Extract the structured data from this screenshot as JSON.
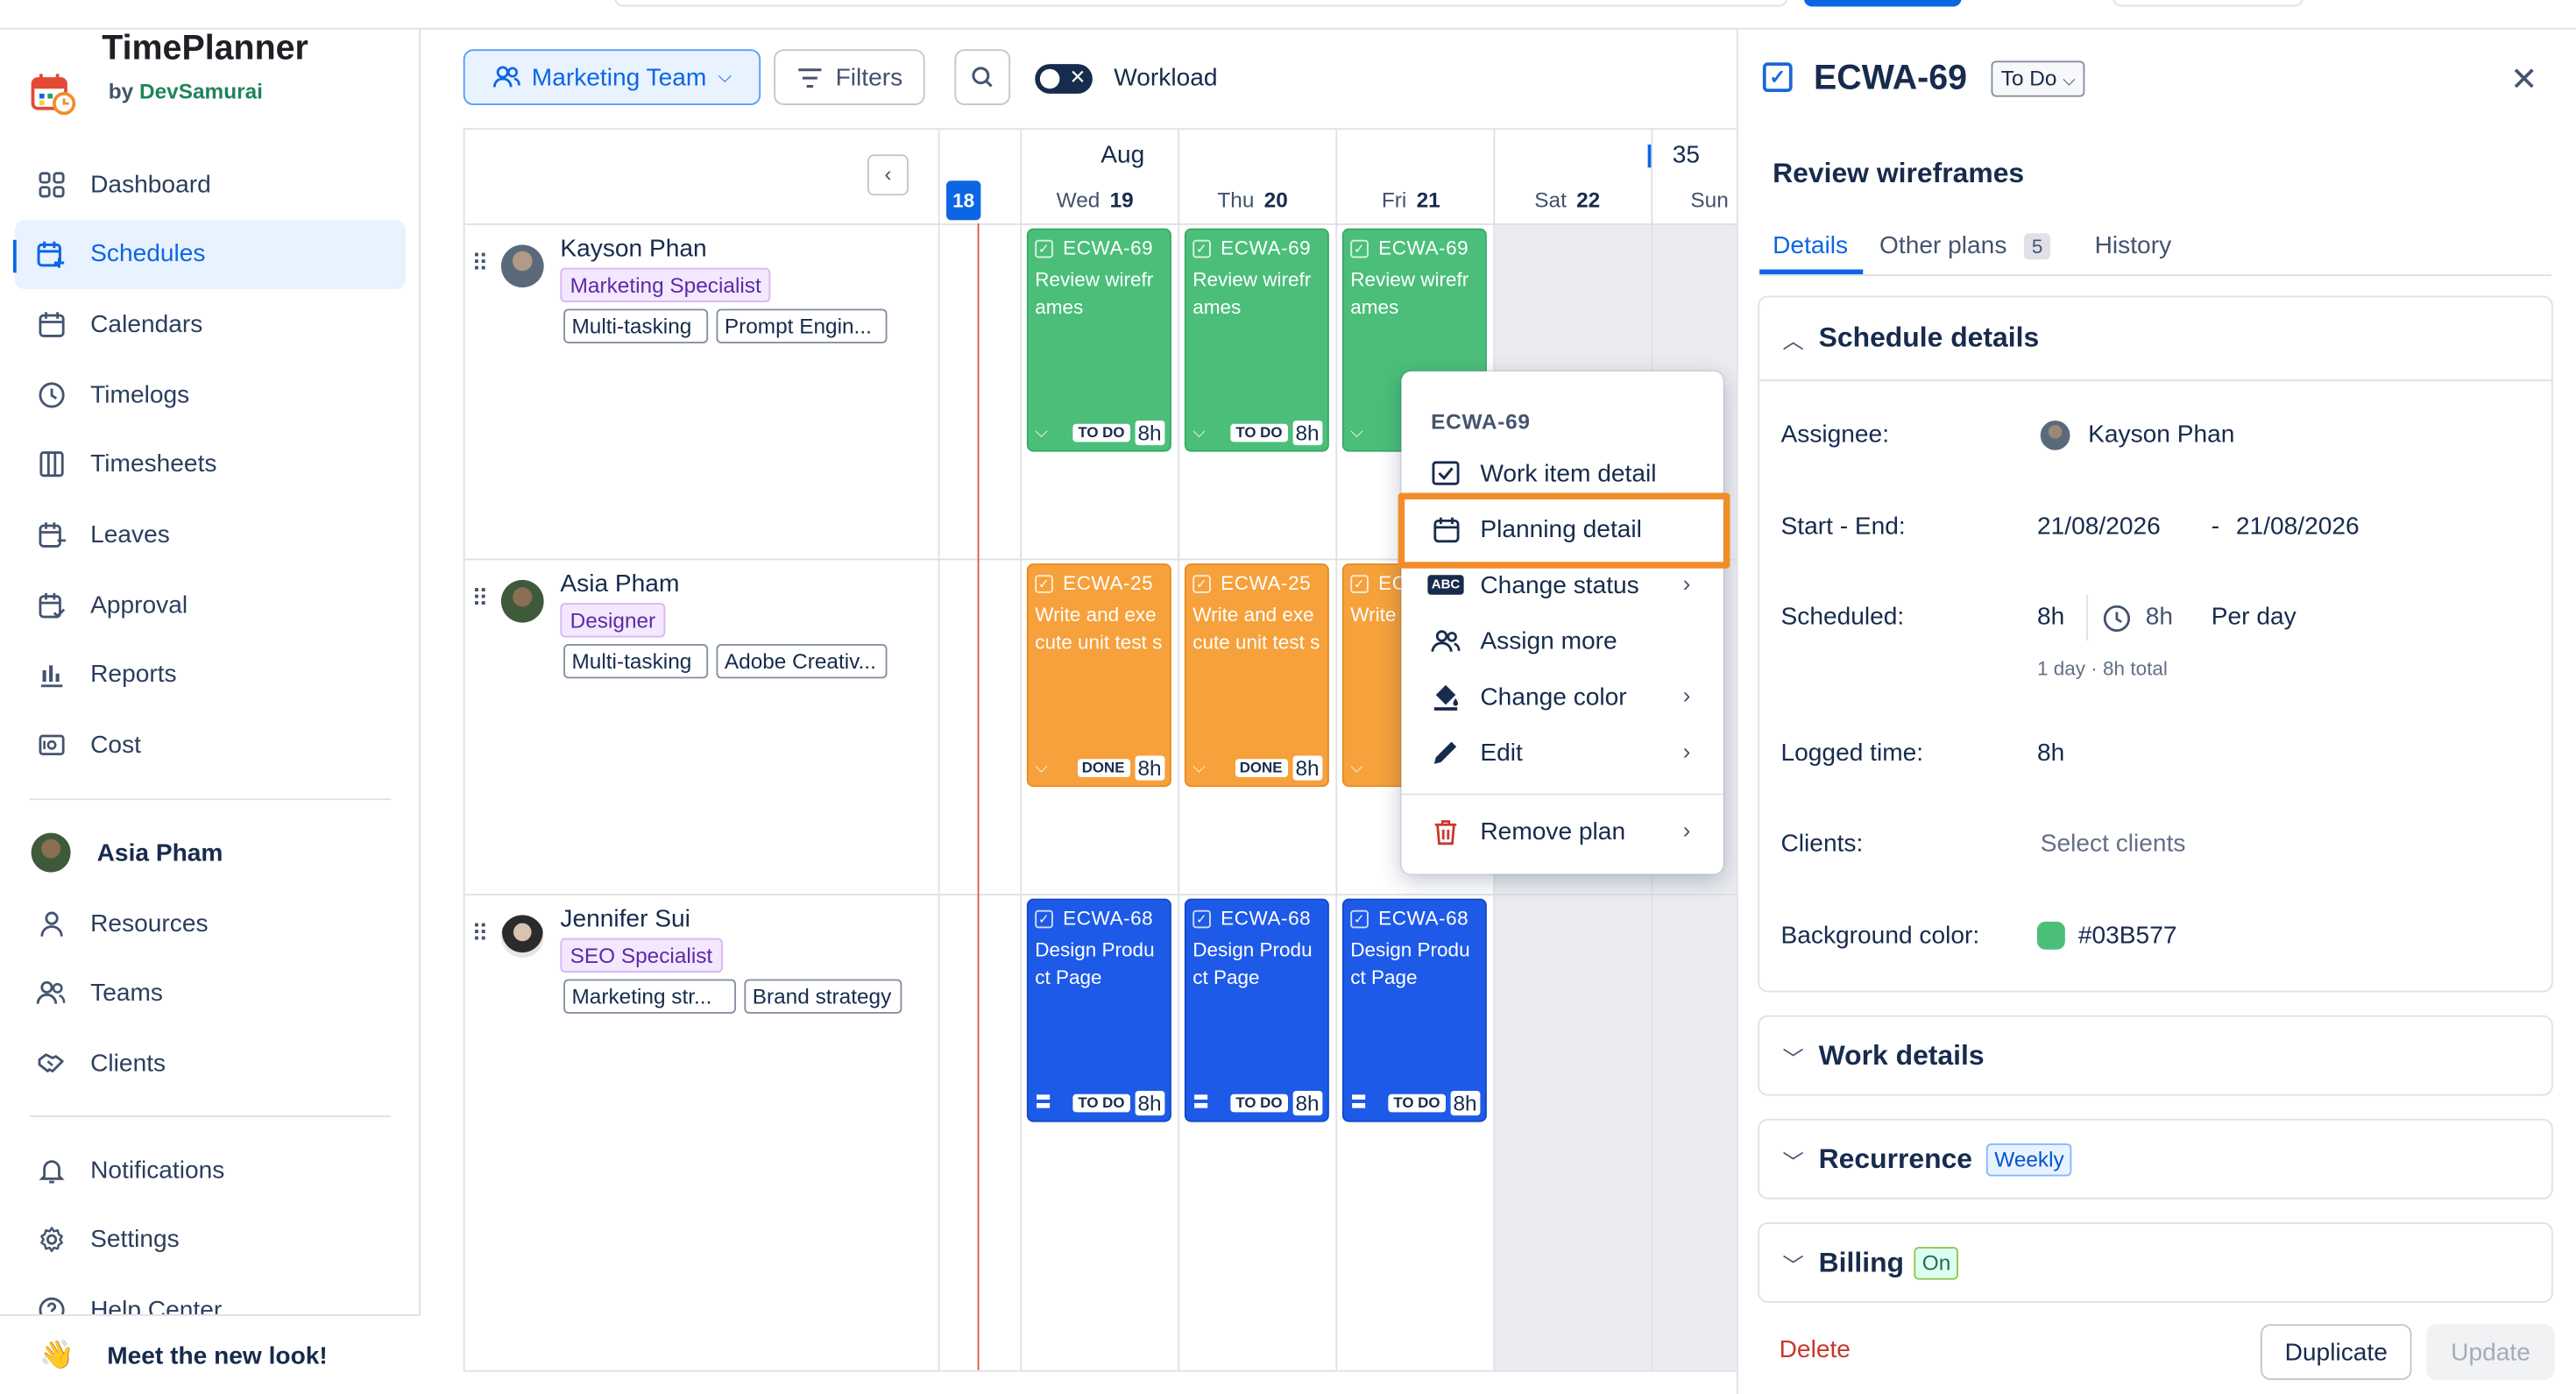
{
  "app": {
    "title": "TimePlanner",
    "by": "by",
    "vendor": "DevSamurai"
  },
  "sidebar": {
    "items": [
      {
        "label": "Dashboard",
        "icon": "dashboard-icon"
      },
      {
        "label": "Schedules",
        "icon": "schedules-icon"
      },
      {
        "label": "Calendars",
        "icon": "calendar-icon"
      },
      {
        "label": "Timelogs",
        "icon": "clock-icon"
      },
      {
        "label": "Timesheets",
        "icon": "timesheet-icon"
      },
      {
        "label": "Leaves",
        "icon": "leaves-icon"
      },
      {
        "label": "Approval",
        "icon": "approval-icon"
      },
      {
        "label": "Reports",
        "icon": "bar-chart-icon"
      },
      {
        "label": "Cost",
        "icon": "cost-icon"
      }
    ],
    "user": "Asia Pham",
    "items2": [
      {
        "label": "Resources",
        "icon": "person-icon"
      },
      {
        "label": "Teams",
        "icon": "team-icon"
      },
      {
        "label": "Clients",
        "icon": "handshake-icon"
      }
    ],
    "items3": [
      {
        "label": "Notifications",
        "icon": "bell-icon"
      },
      {
        "label": "Settings",
        "icon": "gear-icon"
      },
      {
        "label": "Help Center",
        "icon": "help-icon"
      }
    ],
    "meet": "Meet the new look!"
  },
  "toolbar": {
    "team": "Marketing Team",
    "filters": "Filters",
    "workload": "Workload"
  },
  "calendar": {
    "month": "Aug",
    "week": "35",
    "today": "18",
    "days": [
      {
        "name": "Wed",
        "num": "19"
      },
      {
        "name": "Thu",
        "num": "20"
      },
      {
        "name": "Fri",
        "num": "21"
      },
      {
        "name": "Sat",
        "num": "22"
      },
      {
        "name": "Sun",
        "num": ""
      }
    ],
    "people": [
      {
        "name": "Kayson Phan",
        "role": "Marketing Specialist",
        "skills": [
          "Multi-tasking",
          "Prompt Engin..."
        ]
      },
      {
        "name": "Asia Pham",
        "role": "Designer",
        "skills": [
          "Multi-tasking",
          "Adobe Creativ..."
        ]
      },
      {
        "name": "Jennifer Sui",
        "role": "SEO Specialist",
        "skills": [
          "Marketing str...",
          "Brand strategy"
        ]
      }
    ],
    "cards": {
      "kayson": {
        "key": "ECWA-69",
        "title": "Review wirefr ames",
        "status": "TO DO",
        "hours": "8h",
        "status_partial": "TO"
      },
      "asia": {
        "key": "ECWA-25",
        "title": "Write and exe cute unit test s",
        "status": "DONE",
        "hours": "8h",
        "key_partial": "EC",
        "title_partial": "Write cute u s",
        "status_partial": "DO"
      },
      "jennifer": {
        "key": "ECWA-68",
        "title": "Design Produ ct Page",
        "status": "TO DO",
        "hours": "8h"
      }
    }
  },
  "menu": {
    "header": "ECWA-69",
    "items": [
      {
        "label": "Work item detail",
        "icon": "checkbox-icon"
      },
      {
        "label": "Planning detail",
        "icon": "calendar-icon"
      },
      {
        "label": "Change status",
        "icon": "abc-icon",
        "badge": "ABC"
      },
      {
        "label": "Assign more",
        "icon": "people-icon"
      },
      {
        "label": "Change color",
        "icon": "paint-bucket-icon"
      },
      {
        "label": "Edit",
        "icon": "pencil-icon"
      },
      {
        "label": "Remove plan",
        "icon": "trash-icon"
      }
    ]
  },
  "panel": {
    "key": "ECWA-69",
    "status": "To Do",
    "summary": "Review wireframes",
    "tabs": {
      "details": "Details",
      "other": "Other plans",
      "other_count": "5",
      "history": "History"
    },
    "schedule": {
      "header": "Schedule details",
      "assignee_label": "Assignee:",
      "assignee": "Kayson Phan",
      "dates_label": "Start - End:",
      "start": "21/08/2026",
      "sep": "-",
      "end": "21/08/2026",
      "scheduled_label": "Scheduled:",
      "scheduled": "8h",
      "per_day_hours": "8h",
      "per_day": "Per day",
      "total": "1 day · 8h total",
      "logged_label": "Logged time:",
      "logged": "8h",
      "clients_label": "Clients:",
      "clients_placeholder": "Select clients",
      "bg_label": "Background color:",
      "bg_value": "#03B577"
    },
    "work_details": "Work details",
    "recurrence": "Recurrence",
    "recurrence_badge": "Weekly",
    "billing": "Billing",
    "billing_badge": "On",
    "delete": "Delete",
    "duplicate": "Duplicate",
    "update": "Update"
  },
  "colors": {
    "accent": "#0c66e4",
    "green": "#4bbf7a",
    "orange": "#f6a13b",
    "blue": "#1d5ae8",
    "highlight": "#f28c28",
    "danger": "#c9372c",
    "bg_swatch": "#03B577"
  }
}
